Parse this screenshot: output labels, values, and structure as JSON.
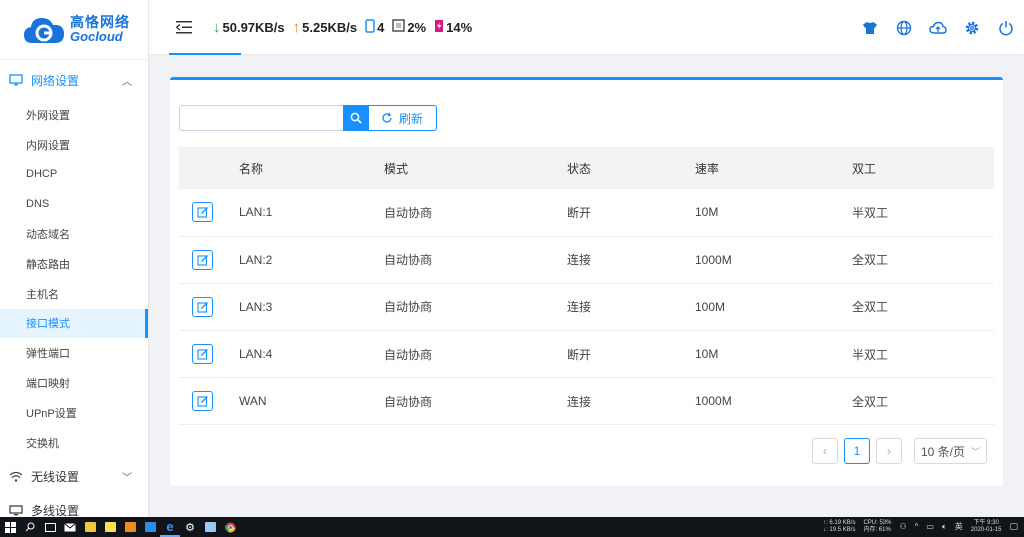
{
  "brand": {
    "name_cn": "高恪网络",
    "name_en": "Gocloud"
  },
  "sidebar": {
    "group_network": {
      "label": "网络设置",
      "icon": "monitor-icon"
    },
    "items": [
      {
        "label": "外网设置"
      },
      {
        "label": "内网设置"
      },
      {
        "label": "DHCP"
      },
      {
        "label": "DNS"
      },
      {
        "label": "动态域名"
      },
      {
        "label": "静态路由"
      },
      {
        "label": "主机名"
      },
      {
        "label": "接口模式"
      },
      {
        "label": "弹性端口"
      },
      {
        "label": "端口映射"
      },
      {
        "label": "UPnP设置"
      },
      {
        "label": "交换机"
      }
    ],
    "active_index": 7,
    "group_wireless": {
      "label": "无线设置",
      "icon": "wifi-icon"
    },
    "group_more": {
      "label": "多线设置"
    }
  },
  "header": {
    "download": "50.97KB/s",
    "upload": "5.25KB/s",
    "devices": "4",
    "cpu": "2%",
    "memory": "14%"
  },
  "toolbar": {
    "search_placeholder": "",
    "refresh_label": "刷新"
  },
  "table": {
    "headers": [
      "名称",
      "模式",
      "状态",
      "速率",
      "双工"
    ],
    "rows": [
      {
        "name": "LAN:1",
        "mode": "自动协商",
        "state": "断开",
        "rate": "10M",
        "duplex": "半双工"
      },
      {
        "name": "LAN:2",
        "mode": "自动协商",
        "state": "连接",
        "rate": "1000M",
        "duplex": "全双工"
      },
      {
        "name": "LAN:3",
        "mode": "自动协商",
        "state": "连接",
        "rate": "100M",
        "duplex": "全双工"
      },
      {
        "name": "LAN:4",
        "mode": "自动协商",
        "state": "断开",
        "rate": "10M",
        "duplex": "半双工"
      },
      {
        "name": "WAN",
        "mode": "自动协商",
        "state": "连接",
        "rate": "1000M",
        "duplex": "全双工"
      }
    ]
  },
  "pagination": {
    "current_page": "1",
    "page_size": "10 条/页"
  },
  "taskbar": {
    "net_up": "↑: 6.19 KB/s",
    "net_down": "↓: 19.5 KB/s",
    "cpu": "CPU: 53%",
    "mem": "内存: 61%",
    "ime": "英",
    "time": "下午 9:30",
    "date": "2020-01-15"
  },
  "colors": {
    "accent": "#1890ff",
    "download": "#2aa84a",
    "upload": "#ef8b1b",
    "memory": "#d6197a"
  }
}
